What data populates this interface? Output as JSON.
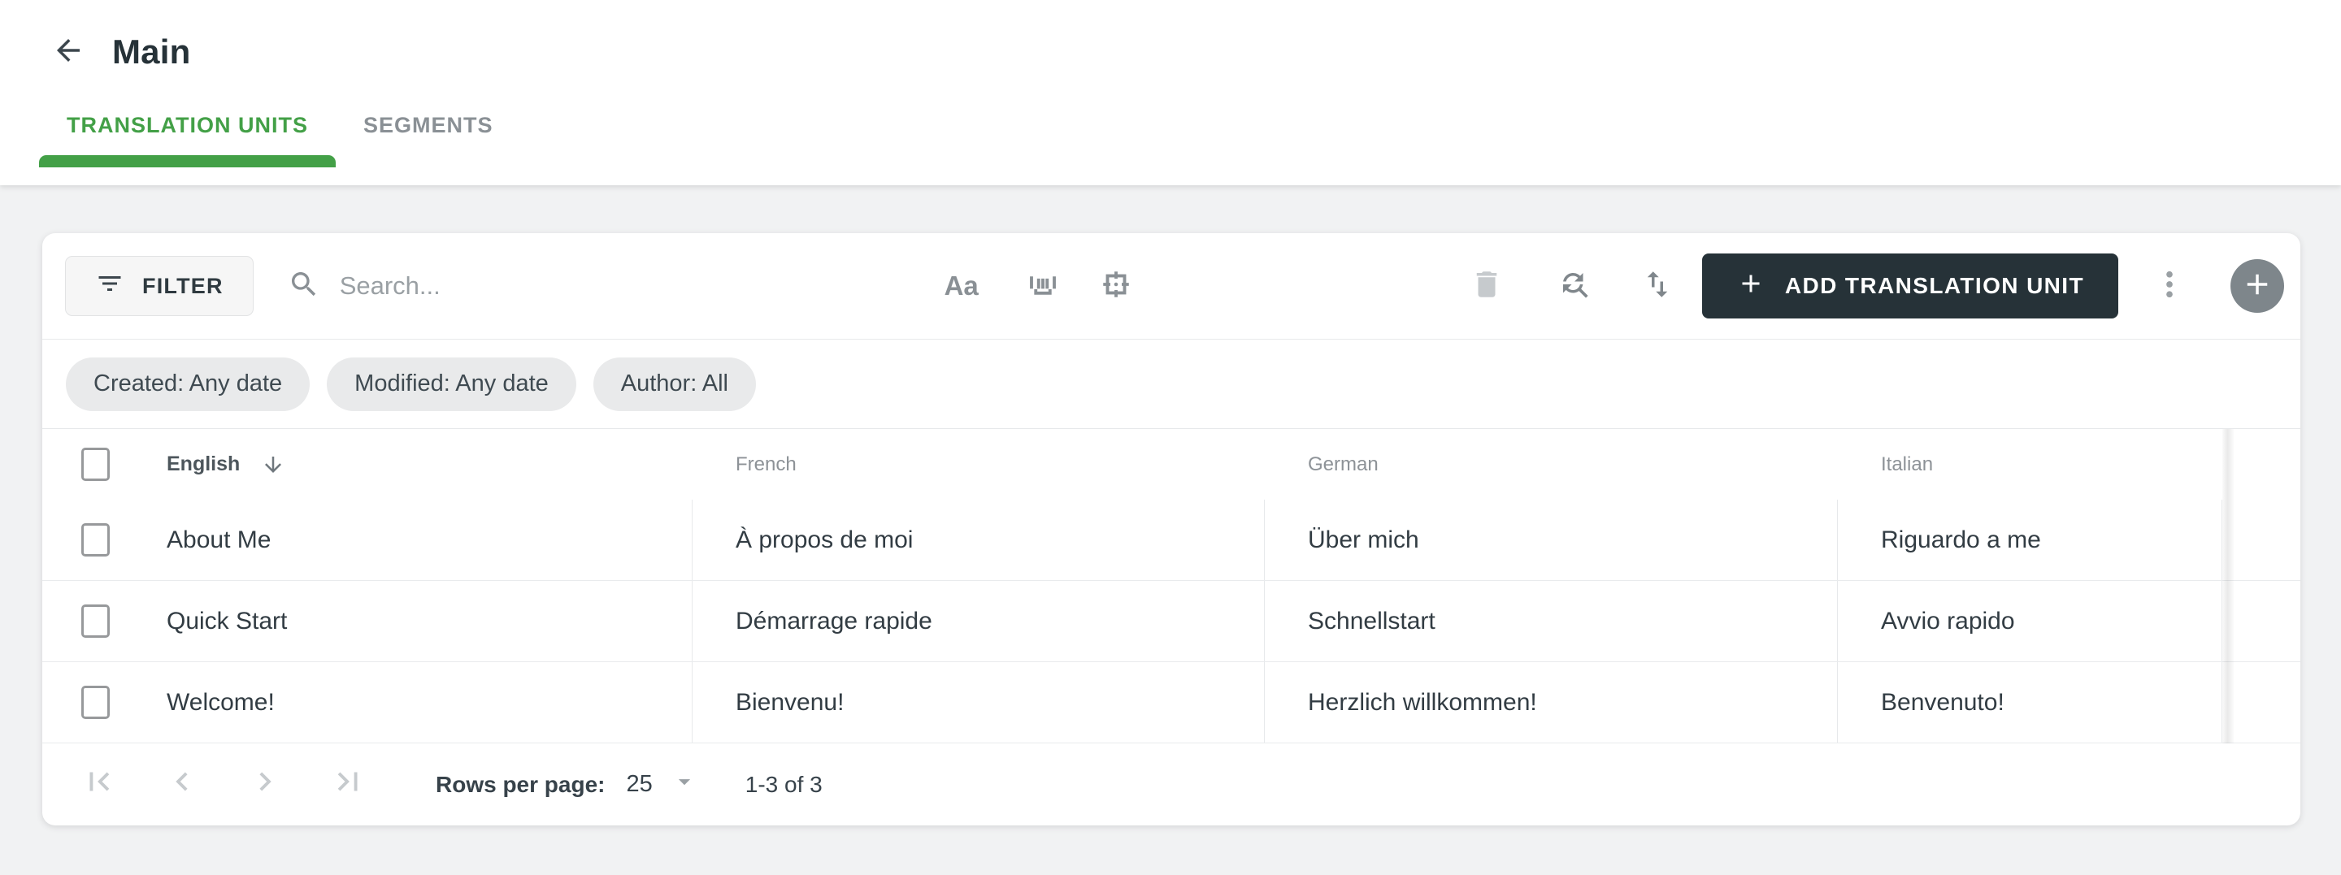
{
  "header": {
    "title": "Main"
  },
  "tabs": {
    "translation_units": "TRANSLATION UNITS",
    "segments": "SEGMENTS"
  },
  "toolbar": {
    "filter_label": "FILTER",
    "search_placeholder": "Search...",
    "match_case_label": "Aa",
    "add_button_label": "ADD TRANSLATION UNIT"
  },
  "filter_chips": {
    "created": "Created: Any date",
    "modified": "Modified: Any date",
    "author": "Author: All"
  },
  "table": {
    "columns": {
      "english": "English",
      "french": "French",
      "german": "German",
      "italian": "Italian"
    },
    "sorted_column": "English",
    "sort_direction": "descending",
    "rows": [
      [
        "About Me",
        "À propos de moi",
        "Über mich",
        "Riguardo a me"
      ],
      [
        "Quick Start",
        "Démarrage rapide",
        "Schnellstart",
        "Avvio rapido"
      ],
      [
        "Welcome!",
        "Bienvenu!",
        "Herzlich willkommen!",
        "Benvenuto!"
      ]
    ]
  },
  "pagination": {
    "rows_per_page_label": "Rows per page:",
    "rows_per_page_value": "25",
    "range_label": "1-3 of 3"
  },
  "colors": {
    "accent_green": "#43a047",
    "primary_button": "#263238",
    "page_background": "#f1f2f3"
  }
}
